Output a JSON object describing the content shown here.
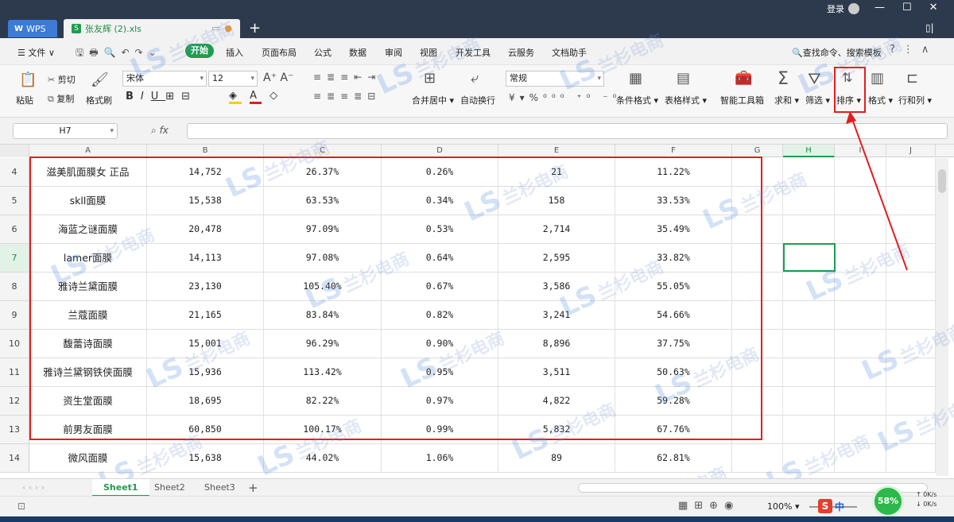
{
  "window": {
    "app_tab": "WPS",
    "file_tab": "张友辉 (2).xls",
    "login": "登录"
  },
  "menu": {
    "file": "文件",
    "home": "开始",
    "items": [
      "插入",
      "页面布局",
      "公式",
      "数据",
      "审阅",
      "视图",
      "开发工具",
      "云服务",
      "文档助手"
    ],
    "search": "查找命令、搜索模板"
  },
  "ribbon": {
    "paste": "粘贴",
    "cut": "剪切",
    "copy": "复制",
    "format_painter": "格式刷",
    "font_name": "宋体",
    "font_size": "12",
    "merge_center": "合并居中",
    "wrap_text": "自动换行",
    "number_format": "常规",
    "cond_format": "条件格式",
    "table_style": "表格样式",
    "smart_toolbox": "智能工具箱",
    "sum": "求和",
    "filter": "筛选",
    "sort": "排序",
    "format": "格式",
    "row_col": "行和列"
  },
  "formula_bar": {
    "cell_ref": "H7",
    "fx": "fx",
    "value": ""
  },
  "columns": [
    "A",
    "B",
    "C",
    "D",
    "E",
    "F",
    "G",
    "H",
    "I",
    "J"
  ],
  "selected_column": "H",
  "rows": [
    {
      "num": "4",
      "name": "滋美肌面膜女 正品",
      "b": "14,752",
      "c": "26.37%",
      "d": "0.26%",
      "e": "21",
      "f": "11.22%"
    },
    {
      "num": "5",
      "name": "skll面膜",
      "b": "15,538",
      "c": "63.53%",
      "d": "0.34%",
      "e": "158",
      "f": "33.53%"
    },
    {
      "num": "6",
      "name": "海蓝之谜面膜",
      "b": "20,478",
      "c": "97.09%",
      "d": "0.53%",
      "e": "2,714",
      "f": "35.49%"
    },
    {
      "num": "7",
      "name": "lamer面膜",
      "b": "14,113",
      "c": "97.08%",
      "d": "0.64%",
      "e": "2,595",
      "f": "33.82%"
    },
    {
      "num": "8",
      "name": "雅诗兰黛面膜",
      "b": "23,130",
      "c": "105.40%",
      "d": "0.67%",
      "e": "3,586",
      "f": "55.05%"
    },
    {
      "num": "9",
      "name": "兰蔻面膜",
      "b": "21,165",
      "c": "83.84%",
      "d": "0.82%",
      "e": "3,241",
      "f": "54.66%"
    },
    {
      "num": "10",
      "name": "馥蕾诗面膜",
      "b": "15,001",
      "c": "96.29%",
      "d": "0.90%",
      "e": "8,896",
      "f": "37.75%"
    },
    {
      "num": "11",
      "name": "雅诗兰黛钢铁侠面膜",
      "b": "15,936",
      "c": "113.42%",
      "d": "0.95%",
      "e": "3,511",
      "f": "50.63%"
    },
    {
      "num": "12",
      "name": "资生堂面膜",
      "b": "18,695",
      "c": "82.22%",
      "d": "0.97%",
      "e": "4,822",
      "f": "59.28%"
    },
    {
      "num": "13",
      "name": "前男友面膜",
      "b": "60,850",
      "c": "100.17%",
      "d": "0.99%",
      "e": "5,832",
      "f": "67.76%"
    },
    {
      "num": "14",
      "name": "微风面膜",
      "b": "15,638",
      "c": "44.02%",
      "d": "1.06%",
      "e": "89",
      "f": "62.81%"
    }
  ],
  "selected_row": "7",
  "sheets": [
    "Sheet1",
    "Sheet2",
    "Sheet3"
  ],
  "active_sheet": "Sheet1",
  "status": {
    "zoom": "100%",
    "cpu": "58%",
    "net_up": "0K/s",
    "net_down": "0K/s",
    "ime": "中"
  },
  "watermark": "兰杉电商",
  "colors": {
    "accent_green": "#1f9c50",
    "highlight_red": "#e21e1e",
    "titlebar": "#2d3a4e"
  }
}
